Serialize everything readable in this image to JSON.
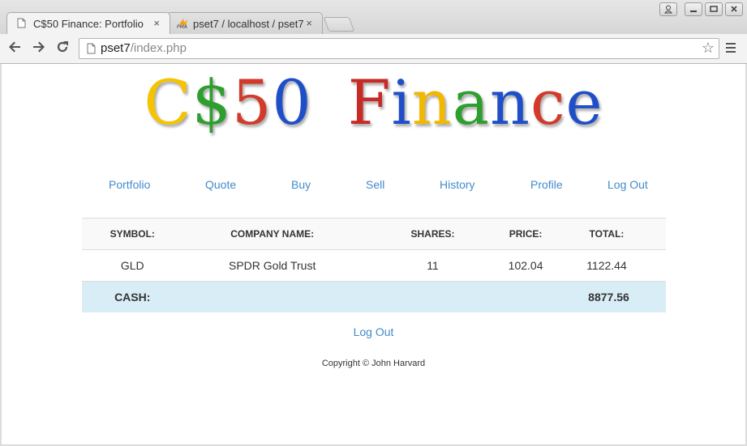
{
  "browser": {
    "tabs": [
      {
        "title": "C$50 Finance: Portfolio",
        "close": "×",
        "icon": "page-icon"
      },
      {
        "title": "pset7 / localhost / pset7",
        "close": "×",
        "icon": "phpmyadmin-icon"
      }
    ],
    "url_host": "pset7",
    "url_path": "/index.php",
    "window_buttons": [
      "user-icon",
      "minimize-icon",
      "maximize-icon",
      "close-icon"
    ]
  },
  "page": {
    "logo_letters": [
      "C",
      "$",
      "5",
      "0",
      "F",
      "i",
      "n",
      "a",
      "n",
      "c",
      "e"
    ],
    "logo_colors": [
      "#f5c400",
      "#2e9e2e",
      "#d23a2a",
      "#1f4fc8",
      "#c82a26",
      "#1f4fc8",
      "#f2b800",
      "#2e9e2e",
      "#1f4fc8",
      "#d23a2a",
      "#1f4fc8"
    ],
    "nav": [
      "Portfolio",
      "Quote",
      "Buy",
      "Sell",
      "History",
      "Profile",
      "Log Out"
    ],
    "table": {
      "headers": [
        "SYMBOL:",
        "COMPANY NAME:",
        "SHARES:",
        "PRICE:",
        "TOTAL:"
      ],
      "rows": [
        {
          "symbol": "GLD",
          "name": "SPDR Gold Trust",
          "shares": "11",
          "price": "102.04",
          "total": "1122.44"
        }
      ],
      "cash_label": "CASH:",
      "cash_value": "8877.56"
    },
    "logout_link": "Log Out",
    "copyright": "Copyright © John Harvard"
  },
  "colors": {
    "link": "#428bca",
    "cash_row": "#d9edf7"
  }
}
